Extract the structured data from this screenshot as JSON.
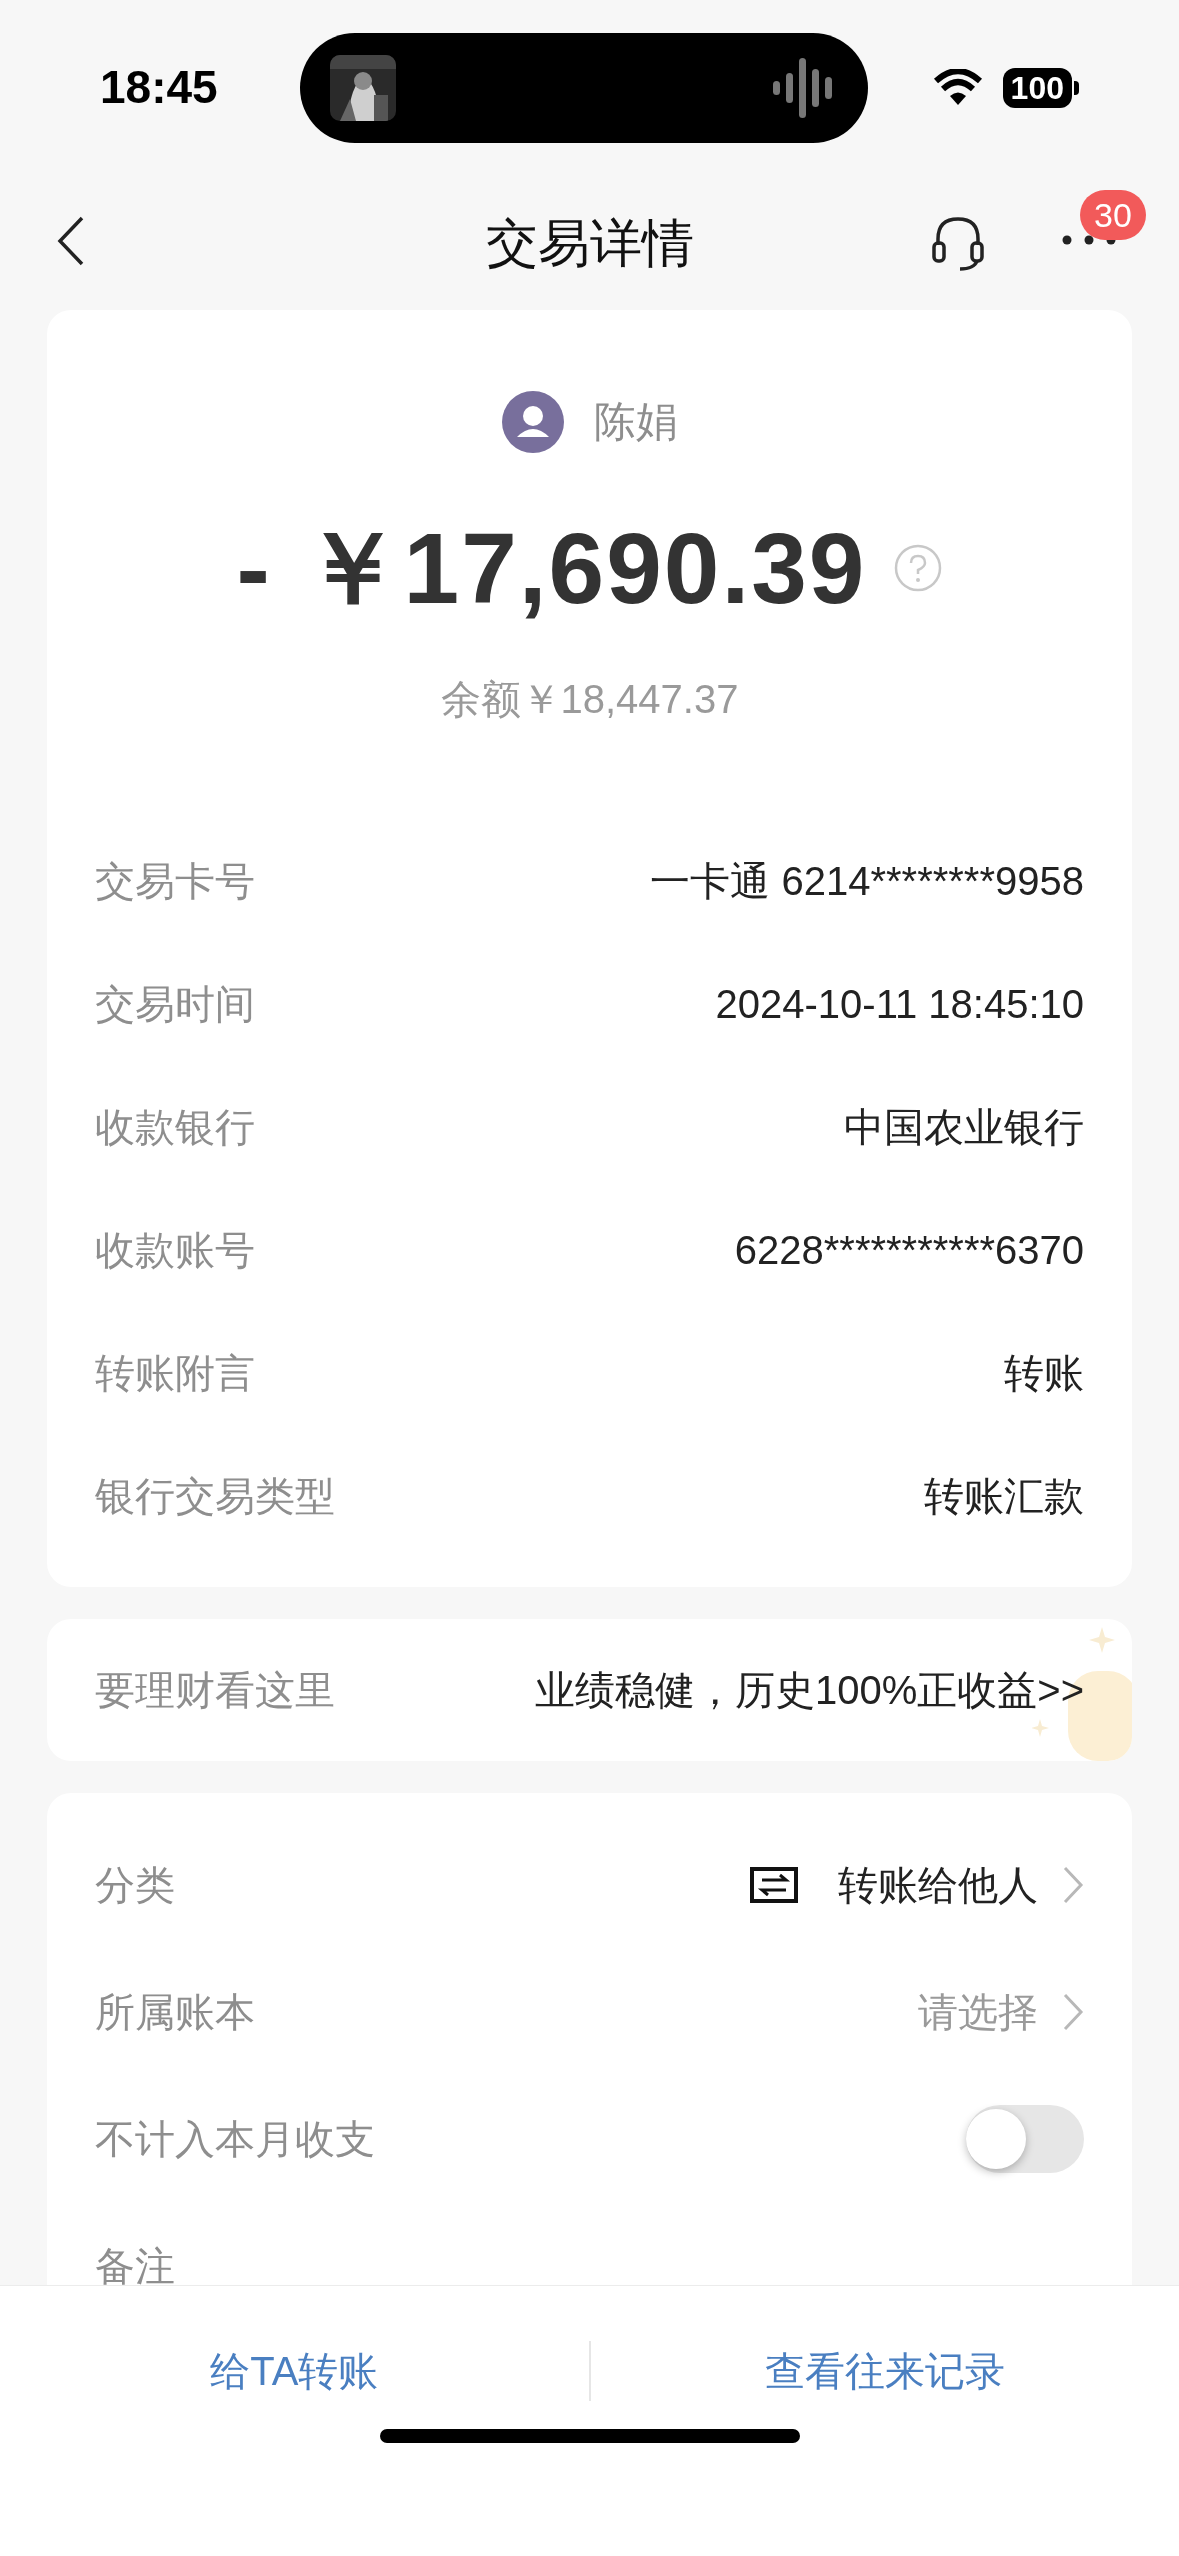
{
  "status_bar": {
    "time": "18:45",
    "battery": "100"
  },
  "nav": {
    "title": "交易详情",
    "badge": "30"
  },
  "header": {
    "name": "陈娟",
    "amount": "- ￥17,690.39",
    "balance": "余额￥18,447.37"
  },
  "details": [
    {
      "label": "交易卡号",
      "value": "一卡通 6214********9958"
    },
    {
      "label": "交易时间",
      "value": "2024-10-11 18:45:10"
    },
    {
      "label": "收款银行",
      "value": "中国农业银行"
    },
    {
      "label": "收款账号",
      "value": "6228***********6370"
    },
    {
      "label": "转账附言",
      "value": "转账"
    },
    {
      "label": "银行交易类型",
      "value": "转账汇款"
    }
  ],
  "promo": {
    "label": "要理财看这里",
    "text": "业绩稳健，历史100%正收益>>"
  },
  "settings": [
    {
      "kind": "category",
      "label": "分类",
      "value": "转账给他人"
    },
    {
      "kind": "select",
      "label": "所属账本",
      "placeholder": "请选择"
    },
    {
      "kind": "toggle",
      "label": "不计入本月收支",
      "on": false
    },
    {
      "kind": "note",
      "label": "备注"
    }
  ],
  "actions": [
    "给TA转账",
    "查看往来记录"
  ]
}
